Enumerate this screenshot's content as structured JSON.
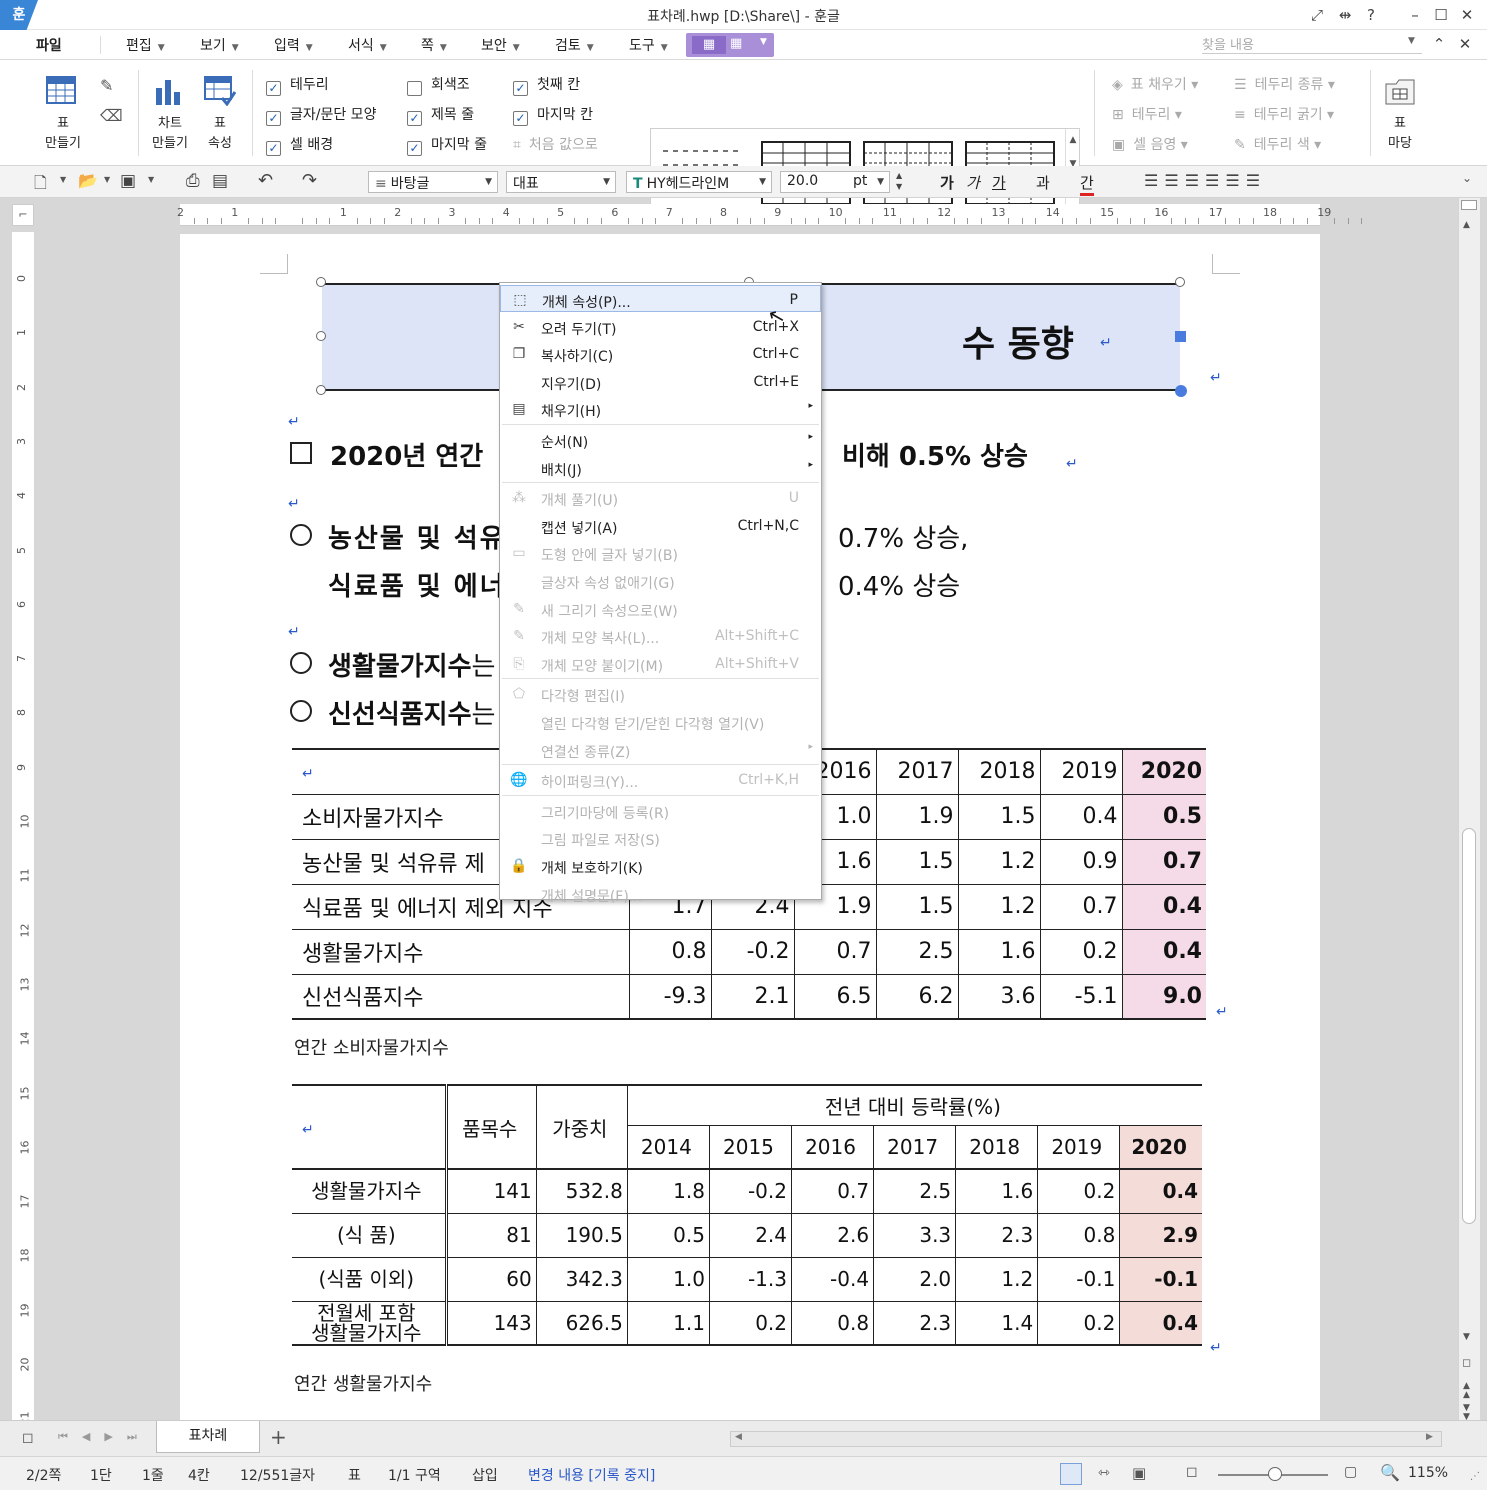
{
  "window": {
    "title": "표차례.hwp [D:\\Share\\] - 훈글",
    "logo": "훈"
  },
  "menubar": {
    "items": [
      "파일",
      "편집",
      "보기",
      "입력",
      "서식",
      "쪽",
      "보안",
      "검토",
      "도구"
    ],
    "find_placeholder": "찾을 내용"
  },
  "ribbon": {
    "make_table": "표\n만들기",
    "make_chart": "차트\n만들기",
    "table_props": "표\n속성",
    "checks": [
      {
        "label": "테두리",
        "checked": true
      },
      {
        "label": "글자/문단 모양",
        "checked": true
      },
      {
        "label": "셀 배경",
        "checked": true
      },
      {
        "label": "회색조",
        "checked": false
      },
      {
        "label": "제목 줄",
        "checked": true
      },
      {
        "label": "마지막 줄",
        "checked": true
      },
      {
        "label": "첫째 칸",
        "checked": true
      },
      {
        "label": "마지막 칸",
        "checked": true
      }
    ],
    "reset": "처음 값으로",
    "fill": "표 채우기",
    "border": "테두리",
    "cell_shade": "셀 음영",
    "border_type": "테두리 종류",
    "border_width": "테두리 굵기",
    "border_color": "테두리 색",
    "table_madang": "표\n마당"
  },
  "format_toolbar": {
    "style": "바탕글",
    "lang": "대표",
    "font": "HY헤드라인M",
    "size": "20.0",
    "unit": "pt"
  },
  "ruler": {
    "h_ticks": [
      "2",
      "1",
      "",
      "1",
      "2",
      "3",
      "4",
      "5",
      "6",
      "7",
      "8",
      "9",
      "10",
      "11",
      "12",
      "13",
      "14",
      "15",
      "16",
      "17",
      "18",
      "19"
    ],
    "v_ticks": [
      "0",
      "1",
      "2",
      "3",
      "4",
      "5",
      "6",
      "7",
      "8",
      "9",
      "10",
      "11",
      "12",
      "13",
      "14",
      "15",
      "16",
      "17",
      "18",
      "19",
      "20",
      "21"
    ]
  },
  "document": {
    "title_tail": "수 동향",
    "p1_left": "2020년 연간",
    "p1_right": "비해 0.5% 상승",
    "p2a_left": "농산물 및 석유",
    "p2a_right": "0.7% 상승,",
    "p2b_left": "식료품 및 에너",
    "p2b_right": "0.4% 상승",
    "p3": "생활물가지수",
    "p3_tail": "는",
    "p4": "신선식품지수",
    "p4_tail": "는",
    "caption1": "연간 소비자물가지수",
    "caption2": "연간 생활물가지수"
  },
  "table1": {
    "years": [
      "2016",
      "2017",
      "2018",
      "2019",
      "2020"
    ],
    "rows": [
      {
        "label": "소비자물가지수",
        "v": [
          "",
          "",
          "1.0",
          "1.9",
          "1.5",
          "0.4",
          "0.5"
        ]
      },
      {
        "label": "농산물 및 석유류 제",
        "v": [
          "",
          "",
          "1.6",
          "1.5",
          "1.2",
          "0.9",
          "0.7"
        ]
      },
      {
        "label": "식료품 및 에너지 제외 지수",
        "v": [
          "1.7",
          "2.4",
          "1.9",
          "1.5",
          "1.2",
          "0.7",
          "0.4"
        ]
      },
      {
        "label": "생활물가지수",
        "v": [
          "0.8",
          "-0.2",
          "0.7",
          "2.5",
          "1.6",
          "0.2",
          "0.4"
        ]
      },
      {
        "label": "신선식품지수",
        "v": [
          "-9.3",
          "2.1",
          "6.5",
          "6.2",
          "3.6",
          "-5.1",
          "9.0"
        ]
      }
    ]
  },
  "table2": {
    "h_count": "품목수",
    "h_weight": "가중치",
    "h_change": "전년 대비 등락률(%)",
    "years": [
      "2014",
      "2015",
      "2016",
      "2017",
      "2018",
      "2019",
      "2020"
    ],
    "rows": [
      {
        "label": "생활물가지수",
        "count": "141",
        "weight": "532.8",
        "v": [
          "1.8",
          "-0.2",
          "0.7",
          "2.5",
          "1.6",
          "0.2",
          "0.4"
        ]
      },
      {
        "label": "(식      품)",
        "count": "81",
        "weight": "190.5",
        "v": [
          "0.5",
          "2.4",
          "2.6",
          "3.3",
          "2.3",
          "0.8",
          "2.9"
        ]
      },
      {
        "label": "(식품 이외)",
        "count": "60",
        "weight": "342.3",
        "v": [
          "1.0",
          "-1.3",
          "-0.4",
          "2.0",
          "1.2",
          "-0.1",
          "-0.1"
        ]
      },
      {
        "label": "전월세 포함\n생활물가지수",
        "count": "143",
        "weight": "626.5",
        "v": [
          "1.1",
          "0.2",
          "0.8",
          "2.3",
          "1.4",
          "0.2",
          "0.4"
        ]
      }
    ]
  },
  "context_menu": [
    {
      "icon": "properties-icon",
      "label": "개체 속성(P)...",
      "shortcut": "P",
      "state": "selected"
    },
    {
      "icon": "scissors-icon",
      "label": "오려 두기(T)",
      "shortcut": "Ctrl+X",
      "state": "normal"
    },
    {
      "icon": "copy-icon",
      "label": "복사하기(C)",
      "shortcut": "Ctrl+C",
      "state": "normal"
    },
    {
      "icon": "",
      "label": "지우기(D)",
      "shortcut": "Ctrl+E",
      "state": "normal"
    },
    {
      "icon": "fill-icon",
      "label": "채우기(H)",
      "shortcut": "",
      "state": "submenu"
    },
    {
      "sep": true
    },
    {
      "icon": "",
      "label": "순서(N)",
      "shortcut": "",
      "state": "submenu"
    },
    {
      "icon": "",
      "label": "배치(J)",
      "shortcut": "",
      "state": "submenu"
    },
    {
      "sep": true
    },
    {
      "icon": "ungroup-icon",
      "label": "개체 풀기(U)",
      "shortcut": "U",
      "state": "disabled"
    },
    {
      "icon": "",
      "label": "캡션 넣기(A)",
      "shortcut": "Ctrl+N,C",
      "state": "normal"
    },
    {
      "icon": "text-in-shape-icon",
      "label": "도형 안에 글자 넣기(B)",
      "shortcut": "",
      "state": "disabled"
    },
    {
      "icon": "",
      "label": "글상자 속성 없애기(G)",
      "shortcut": "",
      "state": "disabled"
    },
    {
      "icon": "new-draw-icon",
      "label": "새 그리기 속성으로(W)",
      "shortcut": "",
      "state": "disabled"
    },
    {
      "icon": "copy-shape-icon",
      "label": "개체 모양 복사(L)...",
      "shortcut": "Alt+Shift+C",
      "state": "disabled"
    },
    {
      "icon": "paste-shape-icon",
      "label": "개체 모양 붙이기(M)",
      "shortcut": "Alt+Shift+V",
      "state": "disabled"
    },
    {
      "sep": true
    },
    {
      "icon": "polygon-icon",
      "label": "다각형 편집(I)",
      "shortcut": "",
      "state": "disabled"
    },
    {
      "icon": "",
      "label": "열린 다각형 닫기/닫힌 다각형 열기(V)",
      "shortcut": "",
      "state": "disabled"
    },
    {
      "icon": "",
      "label": "연결선 종류(Z)",
      "shortcut": "",
      "state": "disabled-submenu"
    },
    {
      "sep": true
    },
    {
      "icon": "hyperlink-icon",
      "label": "하이퍼링크(Y)...",
      "shortcut": "Ctrl+K,H",
      "state": "disabled"
    },
    {
      "sep": true
    },
    {
      "icon": "",
      "label": "그리기마당에 등록(R)",
      "shortcut": "",
      "state": "disabled"
    },
    {
      "icon": "",
      "label": "그림 파일로 저장(S)",
      "shortcut": "",
      "state": "disabled"
    },
    {
      "icon": "lock-icon",
      "label": "개체 보호하기(K)",
      "shortcut": "",
      "state": "normal"
    },
    {
      "icon": "",
      "label": "개체 설명문(F)...",
      "shortcut": "",
      "state": "disabled"
    }
  ],
  "sheet_tab": "표차례",
  "status": {
    "page": "2/2쪽",
    "column": "1단",
    "line": "1줄",
    "col": "4칸",
    "chars": "12/551글자",
    "obj": "표",
    "section": "1/1 구역",
    "mode": "삽입",
    "track": "변경 내용 [기록 중지]",
    "zoom": "115%"
  },
  "colors": {
    "accent": "#2a59c9",
    "title_fill": "#dde4f7",
    "highlight": "#f5dbe8"
  }
}
